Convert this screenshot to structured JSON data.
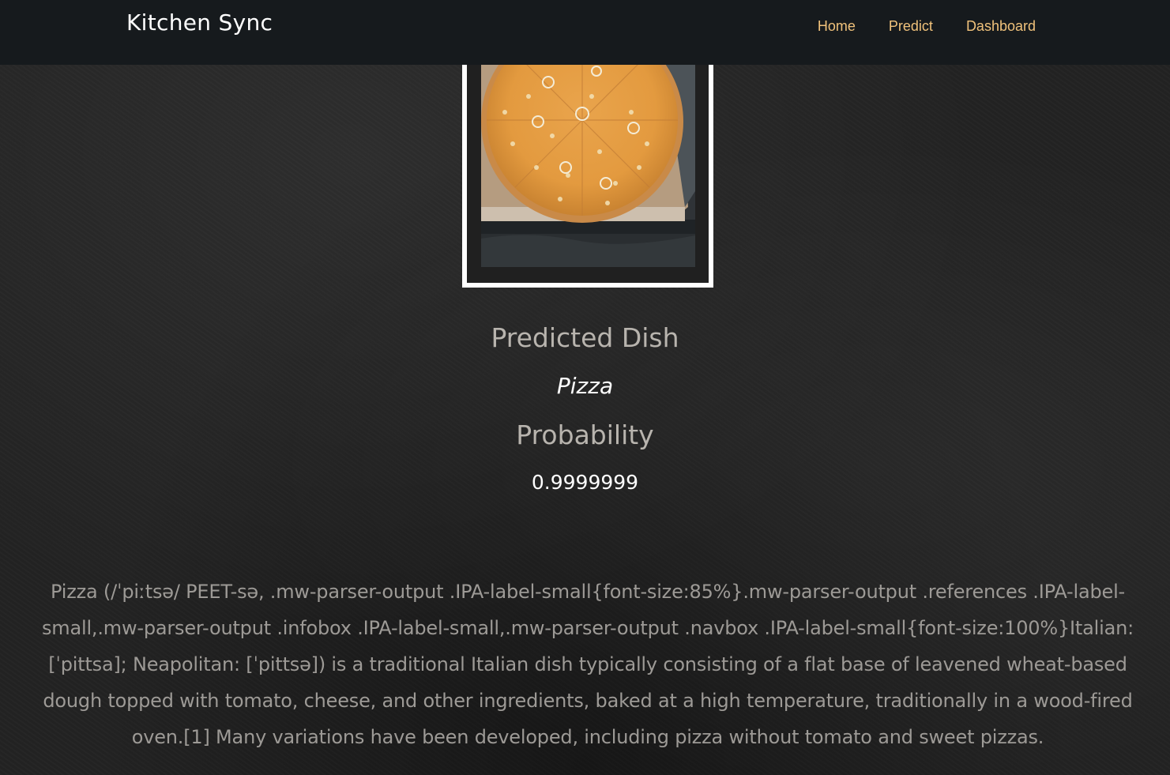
{
  "navbar": {
    "brand": "Kitchen Sync",
    "links": [
      {
        "label": "Home"
      },
      {
        "label": "Predict"
      },
      {
        "label": "Dashboard"
      }
    ]
  },
  "prediction": {
    "dish_heading": "Predicted Dish",
    "dish": "Pizza",
    "probability_heading": "Probability",
    "probability": "0.9999999"
  },
  "description": "Pizza (/ˈpiːtsə/ PEET-sə, .mw-parser-output .IPA-label-small{font-size:85%}.mw-parser-output .references .IPA-label-small,.mw-parser-output .infobox .IPA-label-small,.mw-parser-output .navbox .IPA-label-small{font-size:100%}Italian: [ˈpittsa]; Neapolitan: [ˈpittsə]) is a traditional Italian dish typically consisting of a flat base of leavened wheat-based dough topped with tomato, cheese, and other ingredients, baked at a high temperature, traditionally in a wood-fired oven.[1] Many variations have been developed, including pizza without tomato and sweet pizzas.",
  "colors": {
    "navbar_bg": "#161a1d",
    "nav_link": "#f0c27b",
    "page_bg": "#232323",
    "heading": "#b8b4ae",
    "value_text": "#ffffff",
    "description_text": "#9d9a96"
  }
}
